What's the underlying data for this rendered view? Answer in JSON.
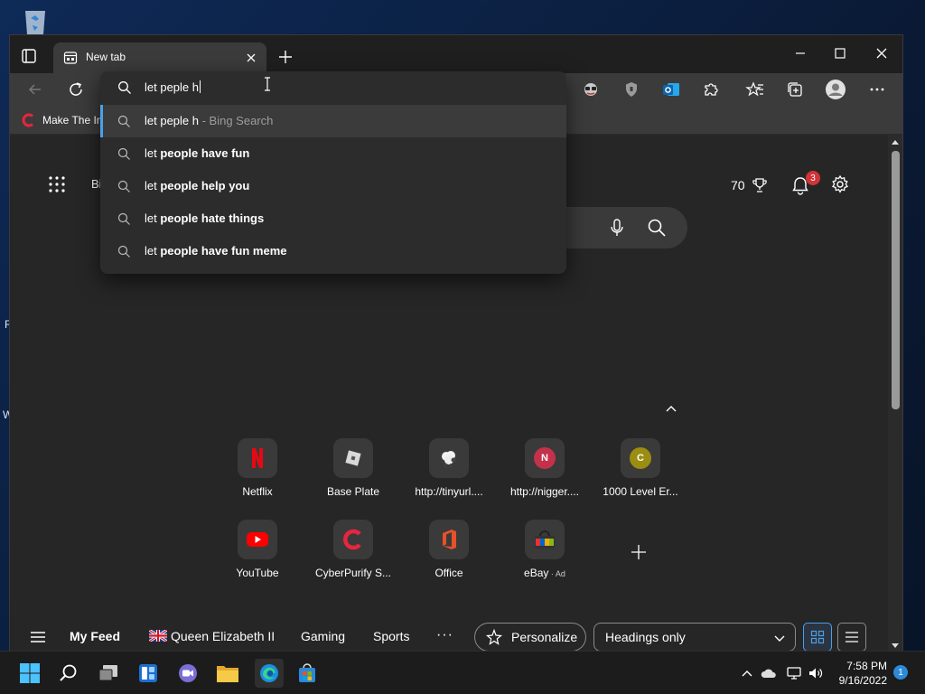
{
  "desktop": {
    "fragment_1": "R",
    "fragment_2": "W"
  },
  "browser": {
    "tab": {
      "title": "New tab"
    },
    "favorites": [
      {
        "label": "Make The Internet"
      }
    ],
    "address_bar": {
      "typed_text": "let peple h",
      "suggestions": [
        {
          "prefix": "let peple h",
          "bold": "",
          "rest": "",
          "suffix": " - Bing Search"
        },
        {
          "prefix": "let ",
          "bold": "people",
          "rest": " have fun",
          "suffix": ""
        },
        {
          "prefix": "let ",
          "bold": "people",
          "rest": " help you",
          "suffix": ""
        },
        {
          "prefix": "let ",
          "bold": "people",
          "rest": " hate things",
          "suffix": ""
        },
        {
          "prefix": "let ",
          "bold": "people",
          "rest": " have fun meme",
          "suffix": ""
        }
      ]
    }
  },
  "newtab": {
    "apps_label": "Bi",
    "points": "70",
    "notification_count": "3",
    "quick_links": [
      {
        "label": "Netflix",
        "icon": "netflix-icon"
      },
      {
        "label": "Base Plate",
        "icon": "roblox-icon"
      },
      {
        "label": "http://tinyurl....",
        "icon": "sheep-icon"
      },
      {
        "label": "http://nigger....",
        "icon": "letter-n-icon",
        "letter": "N"
      },
      {
        "label": "1000 Level Er...",
        "icon": "letter-c-icon",
        "letter": "C"
      },
      {
        "label": "YouTube",
        "icon": "youtube-icon"
      },
      {
        "label": "CyberPurify S...",
        "icon": "cyberpurify-icon"
      },
      {
        "label": "Office",
        "icon": "office-icon"
      },
      {
        "label": "eBay",
        "icon": "ebay-icon",
        "ad": "Ad"
      }
    ],
    "feed": {
      "items": [
        "My Feed",
        "Queen Elizabeth II",
        "Gaming",
        "Sports"
      ],
      "more": "···",
      "personalize": "Personalize",
      "layout_select": "Headings only"
    }
  },
  "taskbar": {
    "time": "7:58 PM",
    "date": "9/16/2022",
    "notification_count": "1"
  },
  "colors": {
    "accent": "#4ba0e8",
    "netflix": "#e50914",
    "badge": "#d13438"
  }
}
